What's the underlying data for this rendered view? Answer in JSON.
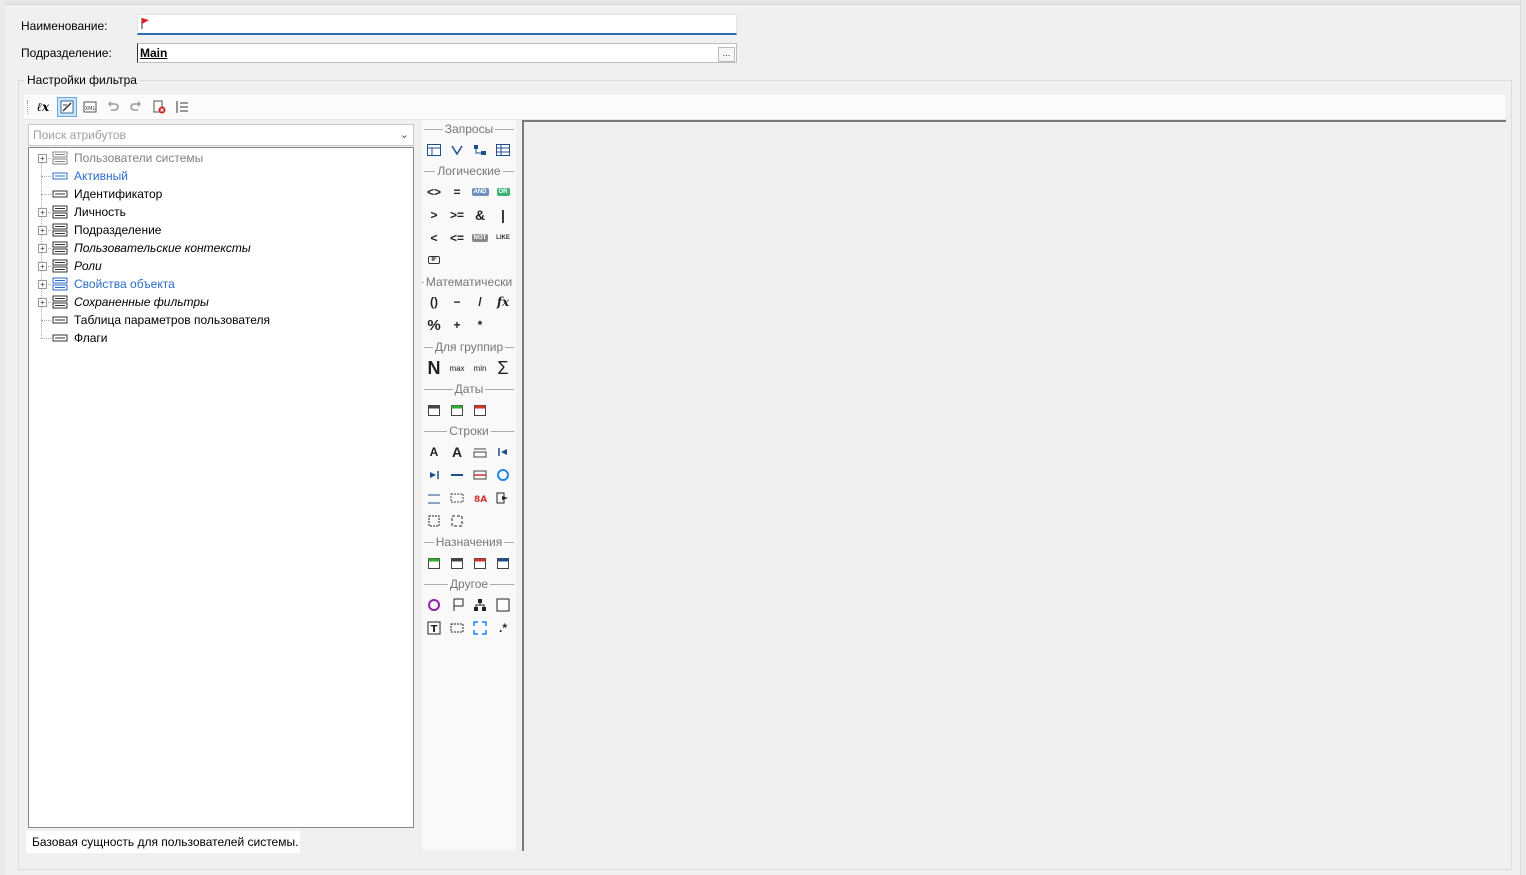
{
  "form": {
    "name_label": "Наименование:",
    "name_value": "",
    "department_label": "Подразделение:",
    "department_value": "Main",
    "browse_button": "..."
  },
  "filter": {
    "group_title": "Настройки фильтра",
    "search_placeholder": "Поиск атрибутов",
    "tree": [
      {
        "label": "Пользователи системы",
        "expandable": true,
        "style": "gray"
      },
      {
        "label": "Активный",
        "expandable": false,
        "style": "blue"
      },
      {
        "label": "Идентификатор",
        "expandable": false,
        "style": "normal"
      },
      {
        "label": "Личность",
        "expandable": true,
        "style": "normal"
      },
      {
        "label": "Подразделение",
        "expandable": true,
        "style": "normal"
      },
      {
        "label": "Пользовательские контексты",
        "expandable": true,
        "style": "italic"
      },
      {
        "label": "Роли",
        "expandable": true,
        "style": "italic"
      },
      {
        "label": "Свойства объекта",
        "expandable": true,
        "style": "blue"
      },
      {
        "label": "Сохраненные фильтры",
        "expandable": true,
        "style": "italic"
      },
      {
        "label": "Таблица параметров пользователя",
        "expandable": false,
        "style": "normal"
      },
      {
        "label": "Флаги",
        "expandable": false,
        "style": "normal"
      }
    ],
    "status_text": "Базовая сущность для пользователей системы."
  },
  "palette": {
    "categories": {
      "queries": "Запросы",
      "logical": "Логические",
      "math": "Математически",
      "groups": "Для группир",
      "dates": "Даты",
      "strings": "Строки",
      "assign": "Назначения",
      "other": "Другое"
    },
    "logical_ops": [
      "<>",
      "=",
      "AND",
      "OR",
      ">",
      ">=",
      "&",
      "|",
      "<",
      "<=",
      "NOT",
      "LIKE",
      "IF"
    ],
    "math_ops": [
      "()",
      "−",
      "/",
      "fx",
      "%",
      "+",
      "*"
    ],
    "group_ops": [
      "N",
      "max",
      "min",
      "Σ"
    ]
  },
  "colors": {
    "accent": "#2b6cb3",
    "link": "#2b6cc9",
    "flag": "#e02020"
  }
}
